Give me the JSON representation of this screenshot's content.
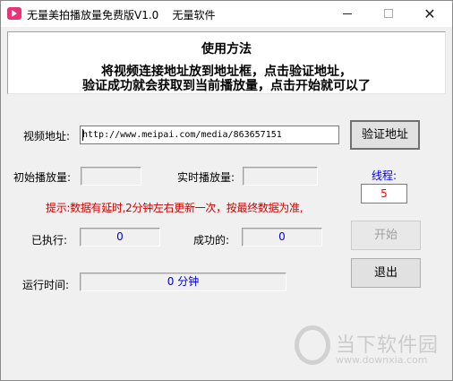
{
  "window": {
    "title": "无量美拍播放量免费版V1.0    无量软件",
    "minimize_glyph": "—",
    "maximize_glyph": "□",
    "close_glyph": "✕"
  },
  "help": {
    "title": "使用方法",
    "line1": "将视频连接地址放到地址框，点击验证地址，",
    "line2": "验证成功就会获取到当前播放量，点击开始就可以了"
  },
  "url": {
    "label": "视频地址:",
    "value": "http://www.meipai.com/media/863657151",
    "verify_button": "验证地址"
  },
  "counts": {
    "initial_label": "初始播放量:",
    "initial_value": "",
    "realtime_label": "实时播放量:",
    "realtime_value": ""
  },
  "threads": {
    "label": "线程:",
    "value": "5"
  },
  "tip": "提示:数据有延时,2分钟左右更新一次，按最终数据为准,",
  "progress": {
    "executed_label": "已执行:",
    "executed_value": "0",
    "success_label": "成功的:",
    "success_value": "0"
  },
  "start_button": "开始",
  "runtime": {
    "label": "运行时间:",
    "value": "0 分钟"
  },
  "exit_button": "退出",
  "watermark": {
    "text": "当下软件园",
    "url": "www.downxia.com"
  }
}
